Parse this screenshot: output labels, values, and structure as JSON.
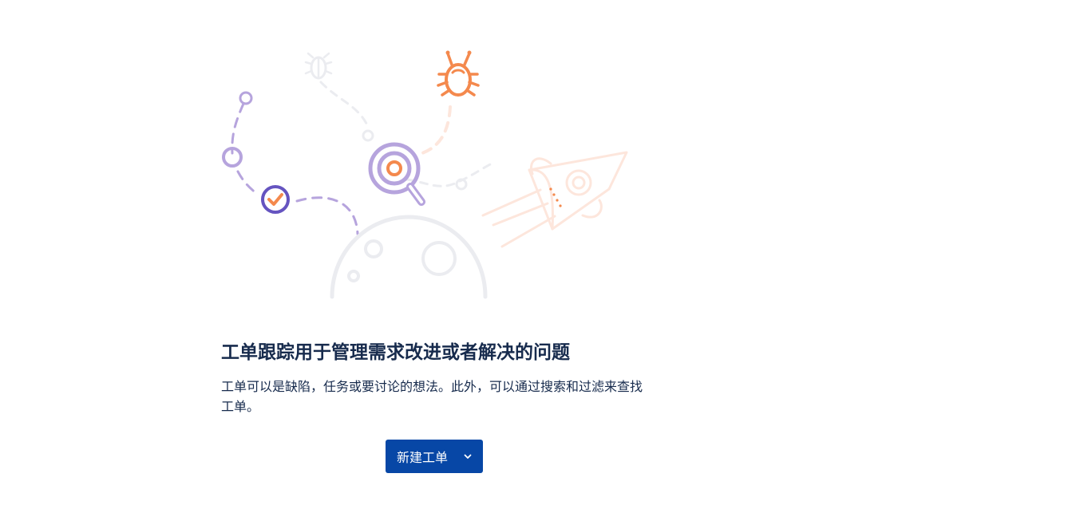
{
  "empty_state": {
    "title": "工单跟踪用于管理需求改进或者解决的问题",
    "description": "工单可以是缺陷，任务或要讨论的想法。此外，可以通过搜索和过滤来查找工单。",
    "create_button_label": "新建工单",
    "create_button_icon": "chevron-down-icon"
  },
  "illustration": {
    "icons": [
      "bug-icon",
      "faded-bug-icon",
      "magnifier-icon",
      "checkmark-icon",
      "rocket-icon",
      "planet-icon"
    ]
  },
  "colors": {
    "accent_blue": "#0747a6",
    "illustration_orange": "#f4894d",
    "illustration_purple": "#b6a4dd",
    "illustration_dark_purple": "#6554c0",
    "illustration_gray": "#ebecf0",
    "illustration_light_orange": "#fde6dc"
  }
}
